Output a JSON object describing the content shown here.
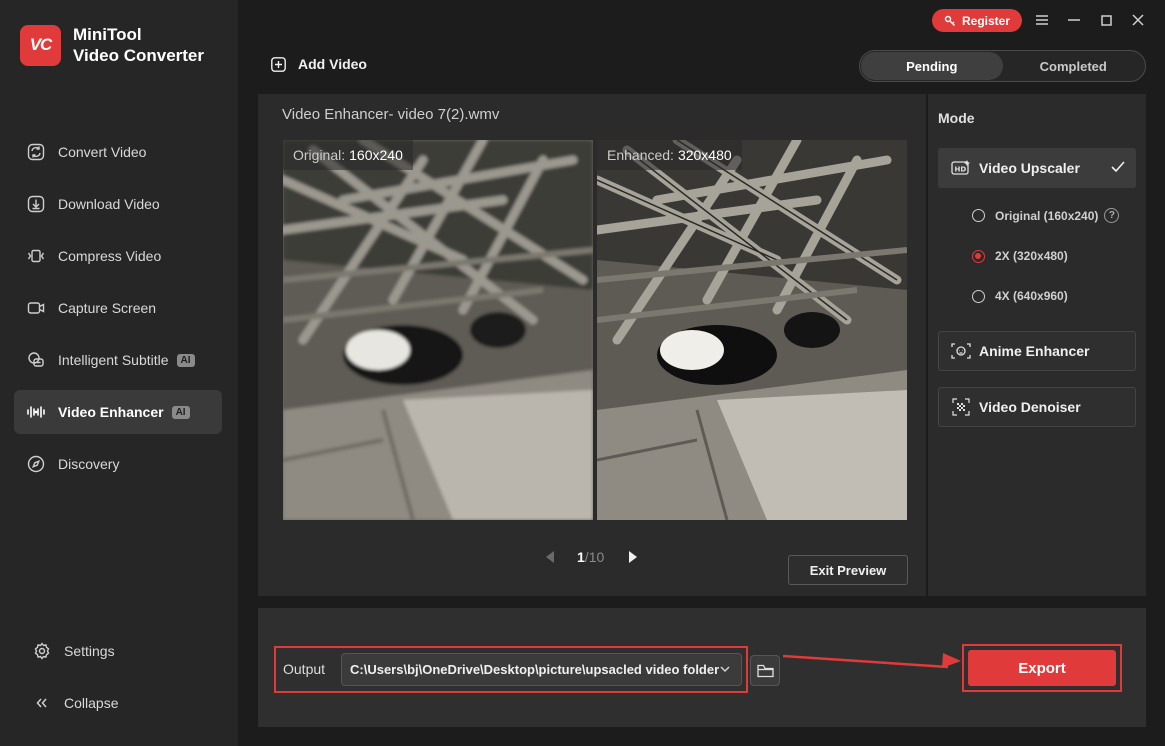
{
  "app": {
    "name_line1": "MiniTool",
    "name_line2": "Video Converter",
    "logo_text": "VC",
    "accent_color": "#e03a3a"
  },
  "titlebar": {
    "register_label": "Register",
    "icons": [
      "menu-icon",
      "minimize-icon",
      "maximize-icon",
      "close-icon"
    ]
  },
  "sidebar": {
    "items": [
      {
        "label": "Convert Video",
        "icon": "convert-icon"
      },
      {
        "label": "Download Video",
        "icon": "download-icon"
      },
      {
        "label": "Compress Video",
        "icon": "compress-icon"
      },
      {
        "label": "Capture Screen",
        "icon": "camera-icon"
      },
      {
        "label": "Intelligent Subtitle",
        "icon": "subtitle-icon",
        "badge": "AI"
      },
      {
        "label": "Video Enhancer",
        "icon": "waveform-icon",
        "badge": "AI",
        "active": true
      },
      {
        "label": "Discovery",
        "icon": "compass-icon"
      }
    ],
    "settings_label": "Settings",
    "collapse_label": "Collapse"
  },
  "toolbar": {
    "add_video_label": "Add Video"
  },
  "tabs": [
    {
      "label": "Pending",
      "active": true
    },
    {
      "label": "Completed",
      "active": false
    }
  ],
  "preview": {
    "title": "Video Enhancer- video 7(2).wmv",
    "original_label": "Original:",
    "original_res": "160x240",
    "enhanced_label": "Enhanced:",
    "enhanced_res": "320x480",
    "page_current": "1",
    "page_sep": "/",
    "page_total": "10",
    "exit_label": "Exit Preview"
  },
  "mode": {
    "title": "Mode",
    "upscaler_label": "Video Upscaler",
    "options": [
      {
        "label": "Original (160x240)",
        "selected": false,
        "help": "?"
      },
      {
        "label": "2X (320x480)",
        "selected": true
      },
      {
        "label": "4X (640x960)",
        "selected": false
      }
    ],
    "anime_label": "Anime Enhancer",
    "denoiser_label": "Video Denoiser"
  },
  "output": {
    "label": "Output",
    "path": "C:\\Users\\bj\\OneDrive\\Desktop\\picture\\upsacled video folder",
    "export_label": "Export"
  }
}
